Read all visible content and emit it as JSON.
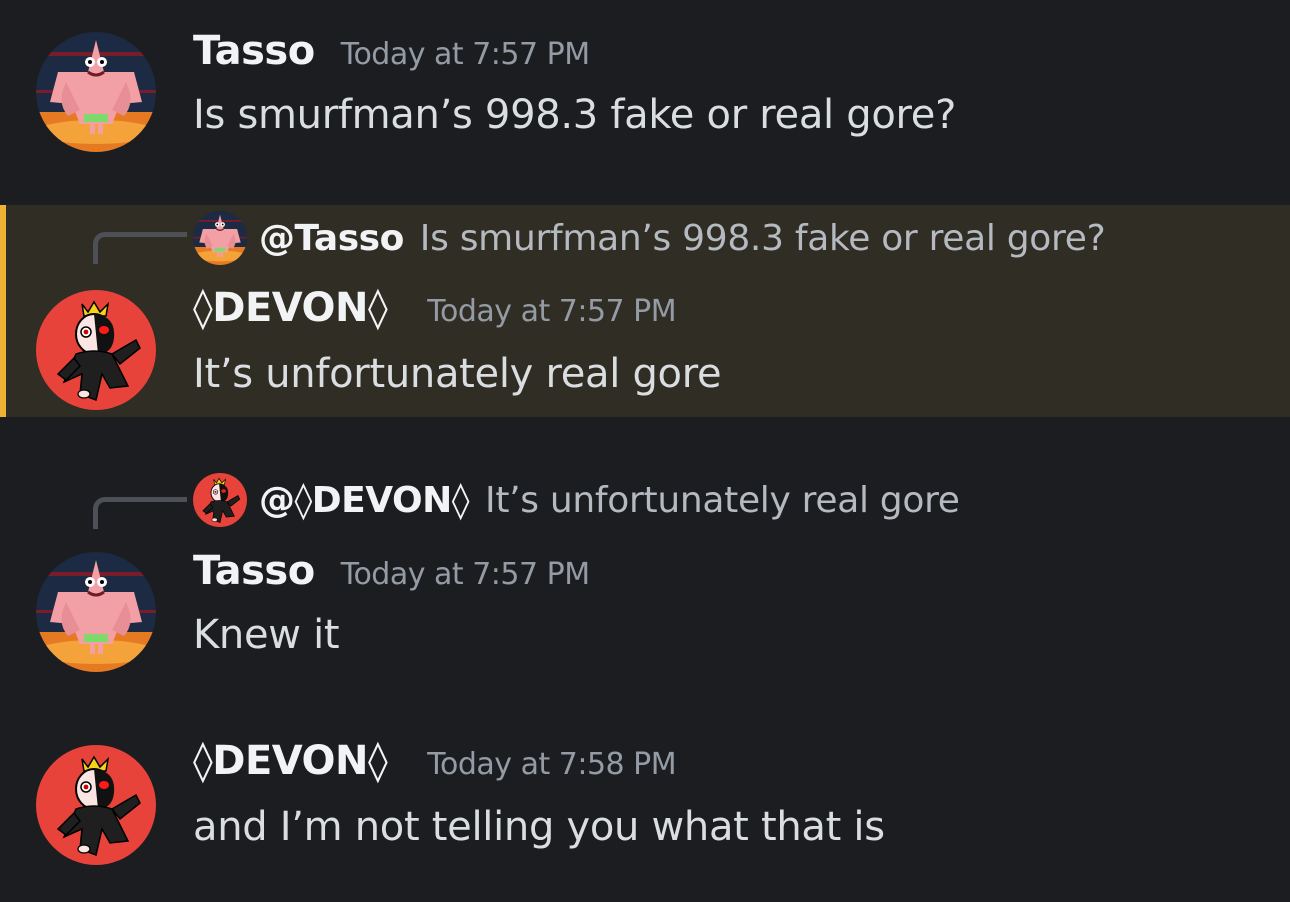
{
  "messages": [
    {
      "author": "Tasso",
      "timestamp": "Today at 7:57 PM",
      "content": "Is smurfman’s 998.3 fake or real gore?",
      "avatar": "starfish-avatar"
    },
    {
      "author": "◊DEVON◊",
      "timestamp": "Today at 7:57 PM",
      "content": "It’s unfortunately real gore",
      "avatar": "devil-avatar",
      "reply": {
        "author": "@Tasso",
        "content": "Is smurfman’s 998.3 fake or real gore?"
      },
      "highlighted": true,
      "highlight_color": "#f0b232"
    },
    {
      "author": "Tasso",
      "timestamp": "Today at 7:57 PM",
      "content": "Knew it",
      "avatar": "starfish-avatar",
      "reply": {
        "author": "@◊DEVON◊",
        "content": "It’s unfortunately real gore"
      }
    },
    {
      "author": "◊DEVON◊",
      "timestamp": "Today at 7:58 PM",
      "content": "and I’m not telling you what that is",
      "avatar": "devil-avatar"
    }
  ],
  "colors": {
    "background": "#1c1d21",
    "highlight_background": "#2f2d24",
    "mention_bar": "#f0b232",
    "timestamp": "#949ba4",
    "text": "#dbdee1"
  }
}
